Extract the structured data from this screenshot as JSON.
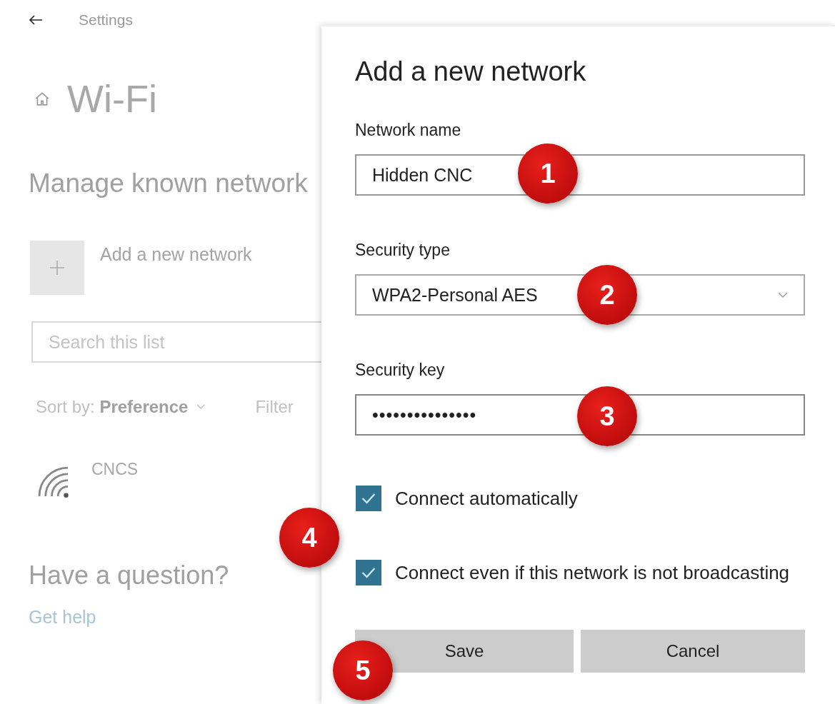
{
  "header": {
    "title": "Settings"
  },
  "page": {
    "title": "Wi-Fi",
    "section_title": "Manage known network",
    "add_network": {
      "label": "Add a new network"
    },
    "search": {
      "placeholder": "Search this list"
    },
    "sort": {
      "text": "Sort by: **Preference**"
    },
    "filter": {
      "label": "Filter"
    },
    "networks": [
      {
        "name": "CNCS"
      }
    ],
    "help": {
      "title": "Have a question?",
      "link": "Get help"
    }
  },
  "dialog": {
    "title": "Add a new network",
    "fields": [
      {
        "kind": "text",
        "label": "Network name",
        "value": "Hidden CNC"
      },
      {
        "kind": "select",
        "label": "Security type",
        "value": "WPA2-Personal AES"
      },
      {
        "kind": "password",
        "label": "Security key",
        "value": "•••••••••••••••"
      }
    ],
    "checkboxes": [
      {
        "label": "Connect automatically",
        "checked": true
      },
      {
        "label": "Connect even if this network is not broadcasting",
        "checked": true
      }
    ],
    "buttons": [
      "Save",
      "Cancel"
    ]
  },
  "annotations": [
    "1",
    "2",
    "3",
    "4",
    "5"
  ]
}
